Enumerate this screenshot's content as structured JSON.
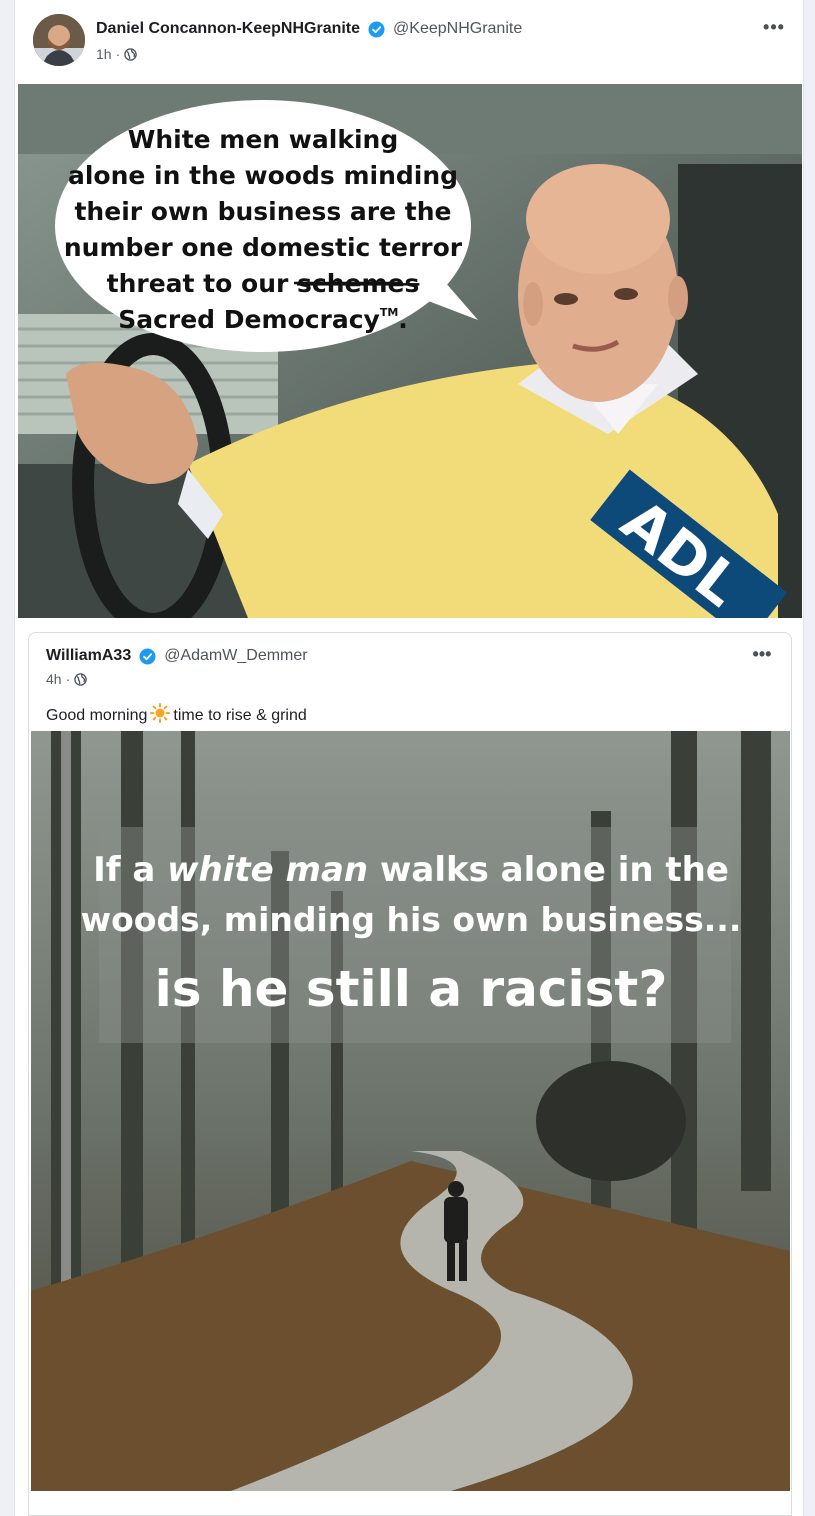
{
  "post": {
    "author_name": "Daniel Concannon-KeepNHGranite",
    "handle": "@KeepNHGranite",
    "time": "1h",
    "separator": "·",
    "more_icon": "more-horizontal-icon",
    "verified_icon": "verified-badge-icon",
    "image": {
      "speech_lines": [
        "White men walking",
        "alone in the woods minding",
        "their own business are the",
        "number one domestic terror"
      ],
      "speech_line5_prefix": "threat to our ",
      "speech_struck": "schemes",
      "speech_line6": "Sacred Democracy",
      "speech_tm": "TM",
      "speech_line6_end": ".",
      "badge_text": "ADL"
    }
  },
  "quoted": {
    "author_name": "WilliamA33",
    "handle": "@AdamW_Demmer",
    "time": "4h",
    "separator": "·",
    "text_before": "Good morning",
    "emoji": "sun-emoji",
    "text_after": "time to rise & grind",
    "image": {
      "line1_a": "If a ",
      "line1_italic": "white man",
      "line1_b": " walks alone in the",
      "line2": "woods, minding his own business...",
      "line3": "is he still a racist?"
    }
  },
  "colors": {
    "verified": "#1d9bf0",
    "sweater": "#f2dc7a",
    "adl_blue": "#0d4a7a"
  }
}
